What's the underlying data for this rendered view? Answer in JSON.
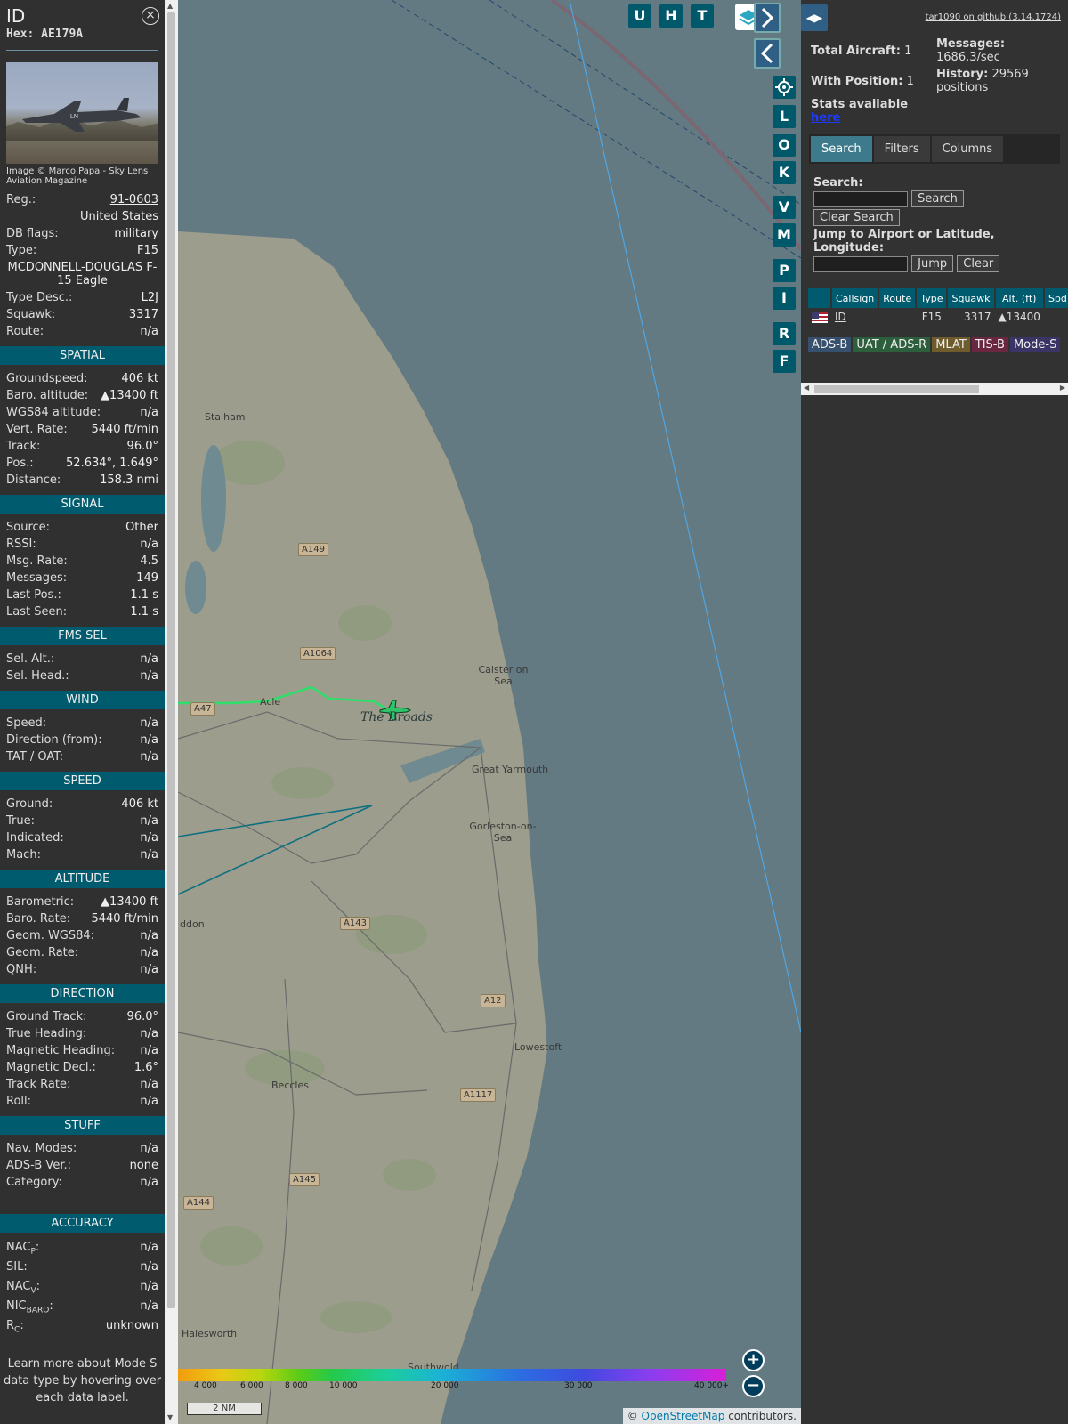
{
  "info": {
    "callsign": "ID",
    "hex_label": "Hex:",
    "hex": "AE179A",
    "close_icon": "×",
    "photo_credit": "Image © Marco Papa - Sky Lens Aviation Magazine",
    "reg_label": "Reg.:",
    "reg": "91-0603",
    "country": "United States",
    "dbflags_label": "DB flags:",
    "dbflags": "military",
    "type_label": "Type:",
    "type": "F15",
    "type_full": "MCDONNELL-DOUGLAS F-15 Eagle",
    "typedesc_label": "Type Desc.:",
    "typedesc": "L2J",
    "squawk_label": "Squawk:",
    "squawk": "3317",
    "route_label": "Route:",
    "route": "n/a",
    "sections": {
      "spatial": "SPATIAL",
      "signal": "SIGNAL",
      "fms": "FMS SEL",
      "wind": "WIND",
      "speed": "SPEED",
      "altitude": "ALTITUDE",
      "direction": "DIRECTION",
      "stuff": "STUFF",
      "accuracy": "ACCURACY"
    },
    "spatial": [
      {
        "label": "Groundspeed:",
        "value": "406 kt"
      },
      {
        "label": "Baro. altitude:",
        "value": "▲13400 ft"
      },
      {
        "label": "WGS84 altitude:",
        "value": "n/a"
      },
      {
        "label": "Vert. Rate:",
        "value": "5440 ft/min"
      },
      {
        "label": "Track:",
        "value": "96.0°"
      },
      {
        "label": "Pos.:",
        "value": "52.634°, 1.649°"
      },
      {
        "label": "Distance:",
        "value": "158.3 nmi"
      }
    ],
    "signal": [
      {
        "label": "Source:",
        "value": "Other"
      },
      {
        "label": "RSSI:",
        "value": "n/a"
      },
      {
        "label": "Msg. Rate:",
        "value": "4.5"
      },
      {
        "label": "Messages:",
        "value": "149"
      },
      {
        "label": "Last Pos.:",
        "value": "1.1 s"
      },
      {
        "label": "Last Seen:",
        "value": "1.1 s"
      }
    ],
    "fms": [
      {
        "label": "Sel. Alt.:",
        "value": "n/a"
      },
      {
        "label": "Sel. Head.:",
        "value": "n/a"
      }
    ],
    "wind": [
      {
        "label": "Speed:",
        "value": "n/a"
      },
      {
        "label": "Direction (from):",
        "value": "n/a"
      },
      {
        "label": "TAT / OAT:",
        "value": "n/a"
      }
    ],
    "speed": [
      {
        "label": "Ground:",
        "value": "406 kt"
      },
      {
        "label": "True:",
        "value": "n/a"
      },
      {
        "label": "Indicated:",
        "value": "n/a"
      },
      {
        "label": "Mach:",
        "value": "n/a"
      }
    ],
    "altitude": [
      {
        "label": "Barometric:",
        "value": "▲13400 ft"
      },
      {
        "label": "Baro. Rate:",
        "value": "5440 ft/min"
      },
      {
        "label": "Geom. WGS84:",
        "value": "n/a"
      },
      {
        "label": "Geom. Rate:",
        "value": "n/a"
      },
      {
        "label": "QNH:",
        "value": "n/a"
      }
    ],
    "direction": [
      {
        "label": "Ground Track:",
        "value": "96.0°"
      },
      {
        "label": "True Heading:",
        "value": "n/a"
      },
      {
        "label": "Magnetic Heading:",
        "value": "n/a"
      },
      {
        "label": "Magnetic Decl.:",
        "value": "1.6°"
      },
      {
        "label": "Track Rate:",
        "value": "n/a"
      },
      {
        "label": "Roll:",
        "value": "n/a"
      }
    ],
    "stuff": [
      {
        "label": "Nav. Modes:",
        "value": "n/a"
      },
      {
        "label": "ADS-B Ver.:",
        "value": "none"
      },
      {
        "label": "Category:",
        "value": "n/a"
      }
    ],
    "accuracy": [
      {
        "label": "NAC",
        "sub": "P",
        "value": "n/a"
      },
      {
        "label": "SIL:",
        "sub": "",
        "value": "n/a"
      },
      {
        "label": "NAC",
        "sub": "V",
        "value": "n/a"
      },
      {
        "label": "NIC",
        "sub": "BARO",
        "value": "n/a"
      },
      {
        "label": "R",
        "sub": "C",
        "value": "unknown"
      }
    ],
    "learn_more": "Learn more about Mode S data type by hovering over each data label."
  },
  "map": {
    "buttons_top": [
      "U",
      "H",
      "T"
    ],
    "buttons_side": [
      "L",
      "O",
      "K",
      "V",
      "M",
      "P",
      "I",
      "R",
      "F"
    ],
    "places": [
      "Stalham",
      "Caister on Sea",
      "Acle",
      "Great Yarmouth",
      "Gorleston-on-Sea",
      "ddon",
      "Lowestoft",
      "Beccles",
      "Halesworth",
      "Southwold"
    ],
    "roads": [
      "A149",
      "A1064",
      "A47",
      "A143",
      "A12",
      "A1117",
      "A145",
      "A144"
    ],
    "broads": "The Broads",
    "scale": "2 NM",
    "attribution_sym": "©",
    "attribution_link": "OpenStreetMap",
    "attribution_text": "contributors.",
    "alt_ticks": [
      "4 000",
      "6 000",
      "8 000",
      "10 000",
      "20 000",
      "30 000",
      "40 000+"
    ],
    "zoom_in": "+",
    "zoom_out": "−"
  },
  "right": {
    "toggle": "◀▶",
    "version": "tar1090 on github (3.14.1724)",
    "total_label": "Total Aircraft:",
    "total": "1",
    "withpos_label": "With Position:",
    "withpos": "1",
    "messages_label": "Messages:",
    "messages": "1686.3/sec",
    "history_label": "History:",
    "history": "29569 positions",
    "stats_label": "Stats available",
    "stats_link": "here",
    "tabs": [
      "Search",
      "Filters",
      "Columns"
    ],
    "search_label": "Search:",
    "search_btn": "Search",
    "clear_search_btn": "Clear Search",
    "jump_label": "Jump to Airport or Latitude, Longitude:",
    "jump_btn": "Jump",
    "clear_btn": "Clear",
    "table": {
      "headers": [
        "",
        "Callsign",
        "Route",
        "Type",
        "Squawk",
        "Alt. (ft)",
        "Spd"
      ],
      "row": {
        "callsign": "ID",
        "route": "",
        "type": "F15",
        "squawk": "3317",
        "alt": "▲13400",
        "spd": ""
      }
    },
    "legend": [
      {
        "label": "ADS-B",
        "color": "#36506e"
      },
      {
        "label": "UAT / ADS-R",
        "color": "#2e5f3d"
      },
      {
        "label": "MLAT",
        "color": "#6e5c2c"
      },
      {
        "label": "TIS-B",
        "color": "#6b2640"
      },
      {
        "label": "Mode-S",
        "color": "#3a3566"
      }
    ]
  },
  "colors": {
    "accent": "#005b6e",
    "panel": "#303030",
    "water": "#637a83",
    "land": "#9c9d8d",
    "track": "#2ee06a"
  }
}
